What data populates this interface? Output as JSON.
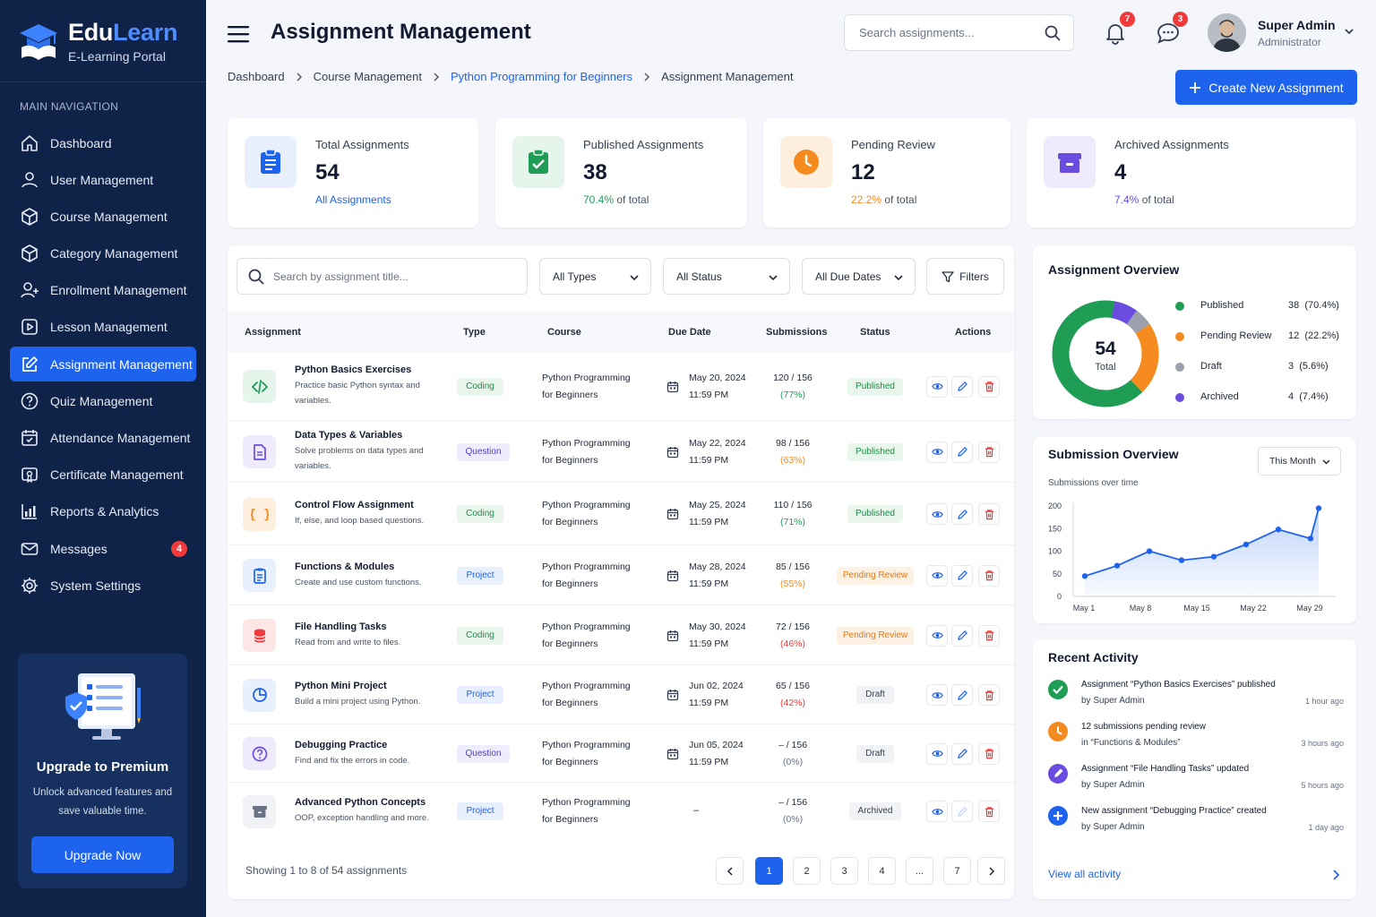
{
  "brand": {
    "name_a": "Edu",
    "name_b": "Learn",
    "subtitle": "E-Learning Portal"
  },
  "sidebar": {
    "heading": "MAIN NAVIGATION",
    "items": [
      {
        "label": "Dashboard",
        "icon": "home-icon"
      },
      {
        "label": "User Management",
        "icon": "user-icon"
      },
      {
        "label": "Course Management",
        "icon": "cube-icon"
      },
      {
        "label": "Category Management",
        "icon": "cube-icon"
      },
      {
        "label": "Enrollment Management",
        "icon": "user-plus-icon"
      },
      {
        "label": "Lesson Management",
        "icon": "play-square-icon"
      },
      {
        "label": "Assignment Management",
        "icon": "edit-icon",
        "active": true
      },
      {
        "label": "Quiz Management",
        "icon": "question-circle-icon"
      },
      {
        "label": "Attendance Management",
        "icon": "calendar-check-icon"
      },
      {
        "label": "Certificate Management",
        "icon": "certificate-icon"
      },
      {
        "label": "Reports & Analytics",
        "icon": "chart-icon"
      },
      {
        "label": "Messages",
        "icon": "mail-icon",
        "badge": "4"
      },
      {
        "label": "System Settings",
        "icon": "gear-icon"
      }
    ],
    "promo": {
      "title": "Upgrade to Premium",
      "text": "Unlock advanced features and save valuable time.",
      "button": "Upgrade Now"
    }
  },
  "header": {
    "title": "Assignment Management",
    "search_placeholder": "Search assignments...",
    "notifications_count": "7",
    "messages_count": "3",
    "user_name": "Super Admin",
    "user_role": "Administrator"
  },
  "breadcrumb": [
    "Dashboard",
    "Course Management",
    "Python Programming for Beginners",
    "Assignment Management"
  ],
  "create_button": "Create New Assignment",
  "stats": [
    {
      "label": "Total Assignments",
      "value": "54",
      "foot_link": "All Assignments",
      "color": "#1e63ee",
      "tint": "#e8f0fd"
    },
    {
      "label": "Published Assignments",
      "value": "38",
      "foot_pct": "70.4%",
      "foot_rest": " of total",
      "color": "#1f9d55",
      "tint": "#e6f5ec"
    },
    {
      "label": "Pending Review",
      "value": "12",
      "foot_pct": "22.2%",
      "foot_rest": " of total",
      "color": "#f58a1f",
      "tint": "#fdeedd"
    },
    {
      "label": "Archived Assignments",
      "value": "4",
      "foot_pct": "7.4%",
      "foot_rest": " of total",
      "color": "#6a4ce0",
      "tint": "#efebfc"
    }
  ],
  "filters": {
    "search_placeholder": "Search by assignment title...",
    "types": "All Types",
    "status": "All Status",
    "due": "All Due Dates",
    "filters": "Filters"
  },
  "table": {
    "headers": [
      "Assignment",
      "Type",
      "Course",
      "Due Date",
      "Submissions",
      "Status",
      "Actions"
    ],
    "rows": [
      {
        "title": "Python Basics Exercises",
        "desc": "Practice basic Python syntax and variables.",
        "type": "Coding",
        "type_class": "coding",
        "course1": "Python Programming",
        "course2": "for Beginners",
        "date": "May 20, 2024",
        "time": "11:59 PM",
        "subs": "120 / 156",
        "pct": "(77%)",
        "pct_color": "#1f9d55",
        "status": "Published",
        "status_class": "published",
        "icon": "code-icon"
      },
      {
        "title": "Data Types & Variables",
        "desc": "Solve problems on data types and variables.",
        "type": "Question",
        "type_class": "question",
        "course1": "Python Programming",
        "course2": "for Beginners",
        "date": "May 22, 2024",
        "time": "11:59 PM",
        "subs": "98 / 156",
        "pct": "(63%)",
        "pct_color": "#f58a1f",
        "status": "Published",
        "status_class": "published",
        "icon": "document-icon"
      },
      {
        "title": "Control Flow Assignment",
        "desc": "If, else, and loop based questions.",
        "type": "Coding",
        "type_class": "coding",
        "course1": "Python Programming",
        "course2": "for Beginners",
        "date": "May 25, 2024",
        "time": "11:59 PM",
        "subs": "110 / 156",
        "pct": "(71%)",
        "pct_color": "#1f9d55",
        "status": "Published",
        "status_class": "published",
        "icon": "braces-icon"
      },
      {
        "title": "Functions & Modules",
        "desc": "Create and use custom functions.",
        "type": "Project",
        "type_class": "project",
        "course1": "Python Programming",
        "course2": "for Beginners",
        "date": "May 28, 2024",
        "time": "11:59 PM",
        "subs": "85 / 156",
        "pct": "(55%)",
        "pct_color": "#f58a1f",
        "status": "Pending Review",
        "status_class": "pending",
        "icon": "clipboard-icon"
      },
      {
        "title": "File Handling Tasks",
        "desc": "Read from and write to files.",
        "type": "Coding",
        "type_class": "coding",
        "course1": "Python Programming",
        "course2": "for Beginners",
        "date": "May 30, 2024",
        "time": "11:59 PM",
        "subs": "72 / 156",
        "pct": "(46%)",
        "pct_color": "#ef3b3b",
        "status": "Pending Review",
        "status_class": "pending",
        "icon": "database-icon"
      },
      {
        "title": "Python Mini Project",
        "desc": "Build a mini project using Python.",
        "type": "Project",
        "type_class": "project",
        "course1": "Python Programming",
        "course2": "for Beginners",
        "date": "Jun 02, 2024",
        "time": "11:59 PM",
        "subs": "65 / 156",
        "pct": "(42%)",
        "pct_color": "#ef3b3b",
        "status": "Draft",
        "status_class": "draft",
        "icon": "pie-chart-icon"
      },
      {
        "title": "Debugging Practice",
        "desc": "Find and fix the errors in code.",
        "type": "Question",
        "type_class": "question",
        "course1": "Python Programming",
        "course2": "for Beginners",
        "date": "Jun 05, 2024",
        "time": "11:59 PM",
        "subs": "– / 156",
        "pct": "(0%)",
        "pct_color": "#667085",
        "status": "Draft",
        "status_class": "draft",
        "icon": "help-circle-icon"
      },
      {
        "title": "Advanced Python Concepts",
        "desc": "OOP, exception handling and more.",
        "type": "Project",
        "type_class": "project",
        "course1": "Python Programming",
        "course2": "for Beginners",
        "date": "",
        "time": "",
        "dash": "–",
        "subs": "– / 156",
        "pct": "(0%)",
        "pct_color": "#667085",
        "status": "Archived",
        "status_class": "archived",
        "icon": "archive-box-icon"
      }
    ],
    "showing": "Showing 1 to 8 of 54 assignments",
    "pages": [
      "1",
      "2",
      "3",
      "4",
      "...",
      "7"
    ]
  },
  "overview": {
    "title": "Assignment Overview",
    "total": "54",
    "total_label": "Total",
    "legend": [
      {
        "name": "Published",
        "value": "38",
        "pct": "(70.4%)",
        "color": "#1f9d55",
        "fraction": 0.704
      },
      {
        "name": "Pending Review",
        "value": "12",
        "pct": "(22.2%)",
        "color": "#f58a1f",
        "fraction": 0.222
      },
      {
        "name": "Draft",
        "value": "3",
        "pct": "(5.6%)",
        "color": "#9aa1ad",
        "fraction": 0.056
      },
      {
        "name": "Archived",
        "value": "4",
        "pct": "(7.4%)",
        "color": "#6a4ce0",
        "fraction": 0.074
      }
    ]
  },
  "submission": {
    "title": "Submission Overview",
    "period": "This Month",
    "subtitle": "Submissions over time"
  },
  "chart_data": {
    "type": "area",
    "title": "Submission Overview",
    "subtitle": "Submissions over time",
    "x_ticks": [
      "May 1",
      "May 8",
      "May 15",
      "May 22",
      "May 29"
    ],
    "y_ticks": [
      "200",
      "150",
      "100",
      "50",
      "0"
    ],
    "ylim": [
      0,
      200
    ],
    "x": [
      1,
      5,
      9,
      13,
      17,
      21,
      25,
      29,
      30
    ],
    "values": [
      45,
      68,
      100,
      80,
      88,
      115,
      148,
      128,
      195
    ],
    "color": "#1e63ee"
  },
  "activity": {
    "title": "Recent Activity",
    "items": [
      {
        "line1": "Assignment “Python Basics Exercises” published",
        "line2": "by Super Admin",
        "time": "1 hour ago",
        "color": "#1f9d55",
        "icon": "check-icon"
      },
      {
        "line1": "12 submissions pending review",
        "line2": "in “Functions & Modules”",
        "time": "3 hours ago",
        "color": "#f58a1f",
        "icon": "clock-icon"
      },
      {
        "line1": "Assignment “File Handling Tasks” updated",
        "line2": "by Super Admin",
        "time": "5 hours ago",
        "color": "#6a4ce0",
        "icon": "pencil-icon"
      },
      {
        "line1": "New assignment “Debugging Practice” created",
        "line2": "by Super Admin",
        "time": "1 day ago",
        "color": "#1e63ee",
        "icon": "plus-icon"
      }
    ],
    "view_all": "View all activity"
  }
}
